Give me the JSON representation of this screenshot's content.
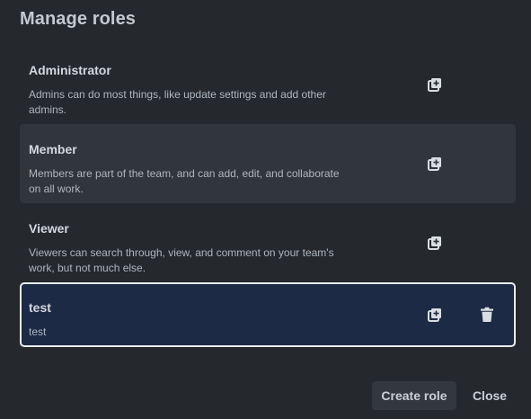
{
  "dialog": {
    "title": "Manage roles"
  },
  "roles": [
    {
      "name": "Administrator",
      "description": "Admins can do most things, like update settings and add other admins."
    },
    {
      "name": "Member",
      "description": "Members are part of the team, and can add, edit, and collaborate on all work."
    },
    {
      "name": "Viewer",
      "description": "Viewers can search through, view, and comment on your team's work, but not much else."
    },
    {
      "name": "test",
      "description": "test"
    }
  ],
  "icons": {
    "copy": "duplicate-role-icon",
    "delete": "trash-icon"
  },
  "footer": {
    "create_label": "Create role",
    "close_label": "Close"
  },
  "colors": {
    "background": "#25282c",
    "hover_row": "#31363d",
    "selected_row": "#1d2a45",
    "selected_border": "#e9ecef",
    "button_bg": "#33383f"
  }
}
